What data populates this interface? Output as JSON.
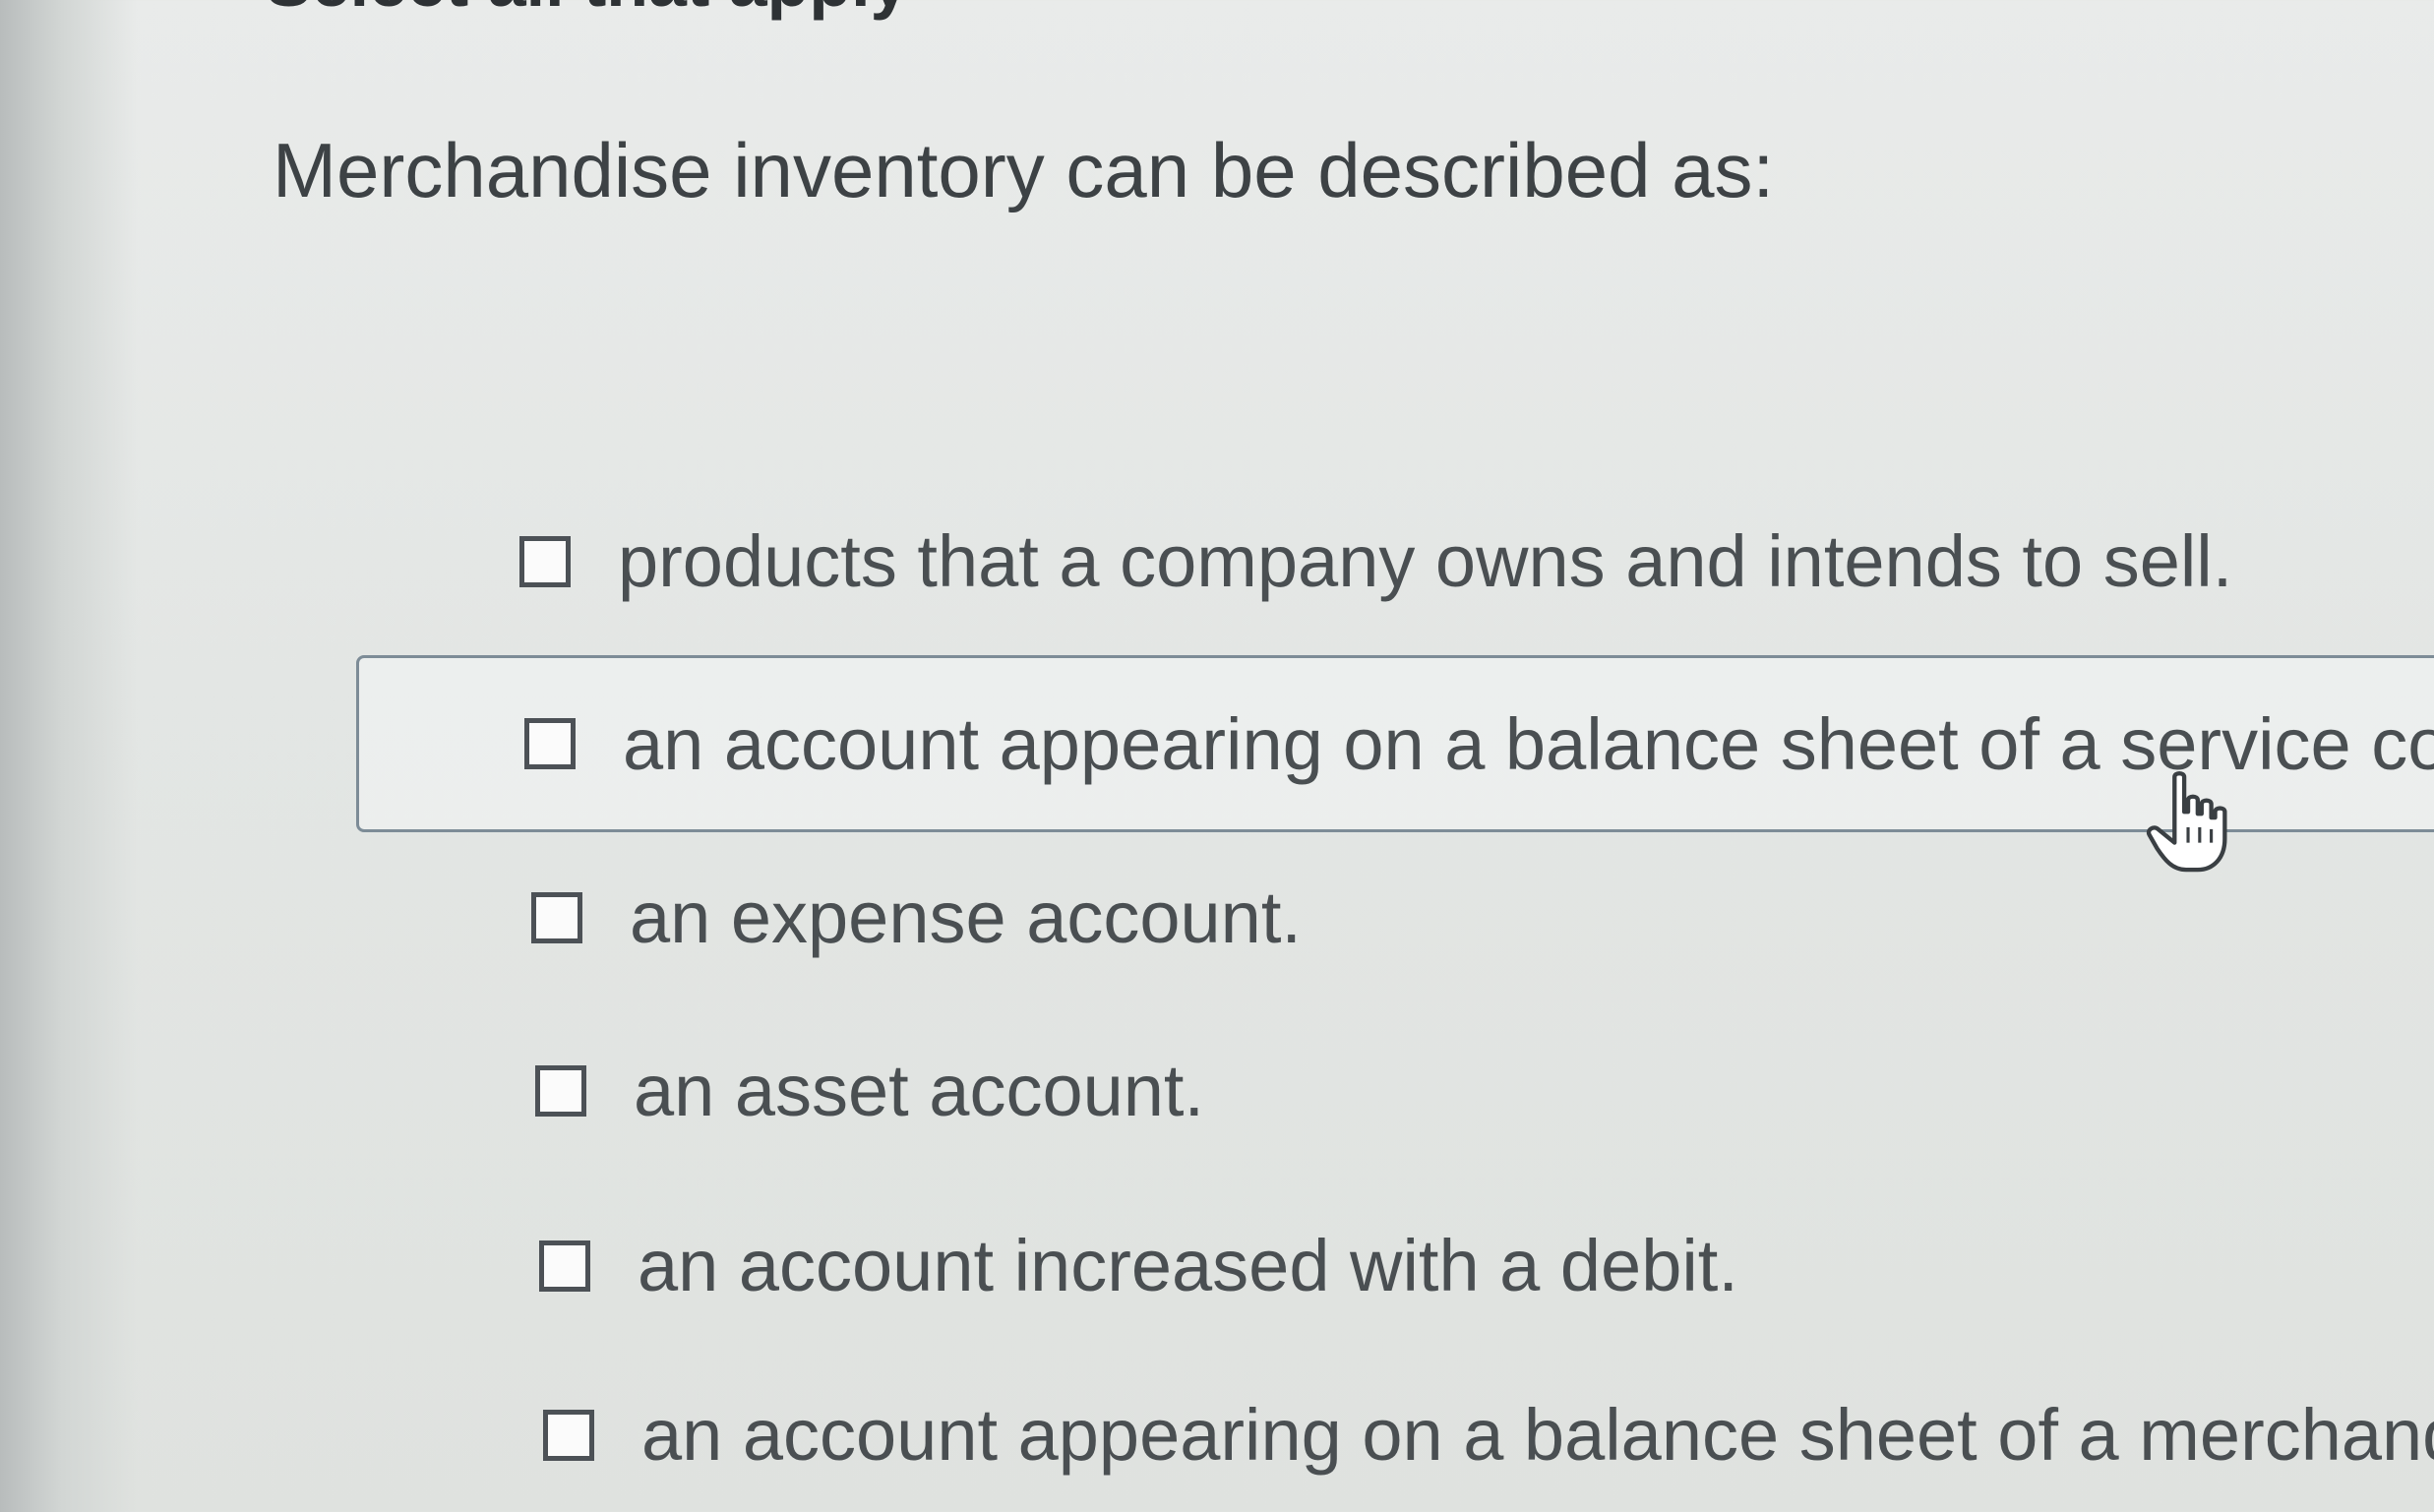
{
  "instruction": "Select all that apply",
  "question": "Merchandise inventory can be described as:",
  "options": [
    {
      "label": "products that a company owns and intends to sell.",
      "checked": false,
      "highlighted": false
    },
    {
      "label": "an account appearing on a balance sheet of a service co",
      "checked": false,
      "highlighted": true
    },
    {
      "label": "an expense account.",
      "checked": false,
      "highlighted": false
    },
    {
      "label": "an asset account.",
      "checked": false,
      "highlighted": false
    },
    {
      "label": "an account increased with a debit.",
      "checked": false,
      "highlighted": false
    },
    {
      "label": "an account appearing on a balance sheet of a merchandis",
      "checked": false,
      "highlighted": false
    }
  ],
  "cursor": {
    "icon": "hand-pointer-icon"
  }
}
